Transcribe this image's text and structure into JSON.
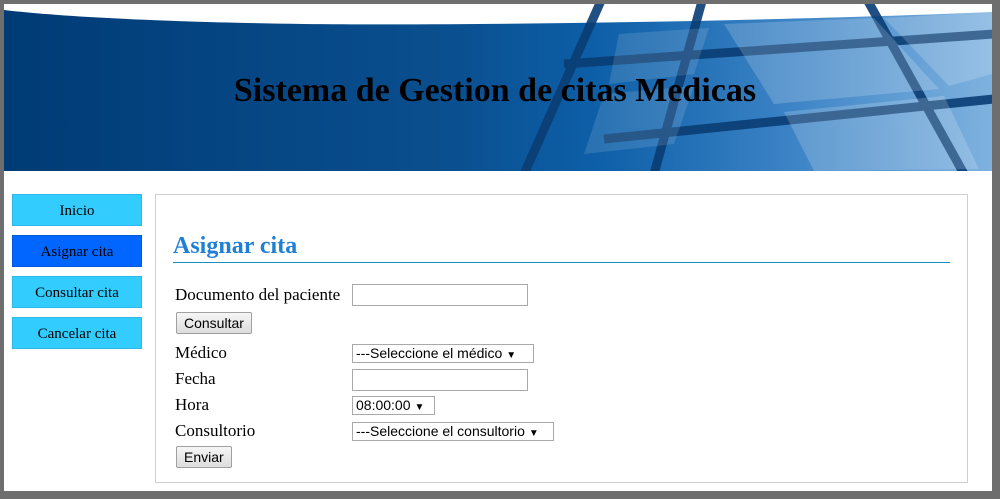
{
  "header": {
    "title": "Sistema de Gestion de citas Medicas"
  },
  "nav": {
    "items": [
      {
        "label": "Inicio",
        "active": false
      },
      {
        "label": "Asignar cita",
        "active": true
      },
      {
        "label": "Consultar cita",
        "active": false
      },
      {
        "label": "Cancelar cita",
        "active": false
      }
    ]
  },
  "main": {
    "heading": "Asignar cita",
    "form": {
      "patient_document_label": "Documento del paciente",
      "patient_document_value": "",
      "consult_button": "Consultar",
      "doctor_label": "Médico",
      "doctor_selected": "---Seleccione el médico",
      "date_label": "Fecha",
      "date_value": "",
      "time_label": "Hora",
      "time_selected": "08:00:00",
      "office_label": "Consultorio",
      "office_selected": "---Seleccione el consultorio",
      "submit_button": "Enviar"
    }
  },
  "colors": {
    "nav_item": "#33ccff",
    "nav_item_active": "#0066ff",
    "heading": "#1e7fd6",
    "banner_dark": "#003b75"
  },
  "icons": {
    "select_arrow": "dropdown-arrow-icon"
  }
}
